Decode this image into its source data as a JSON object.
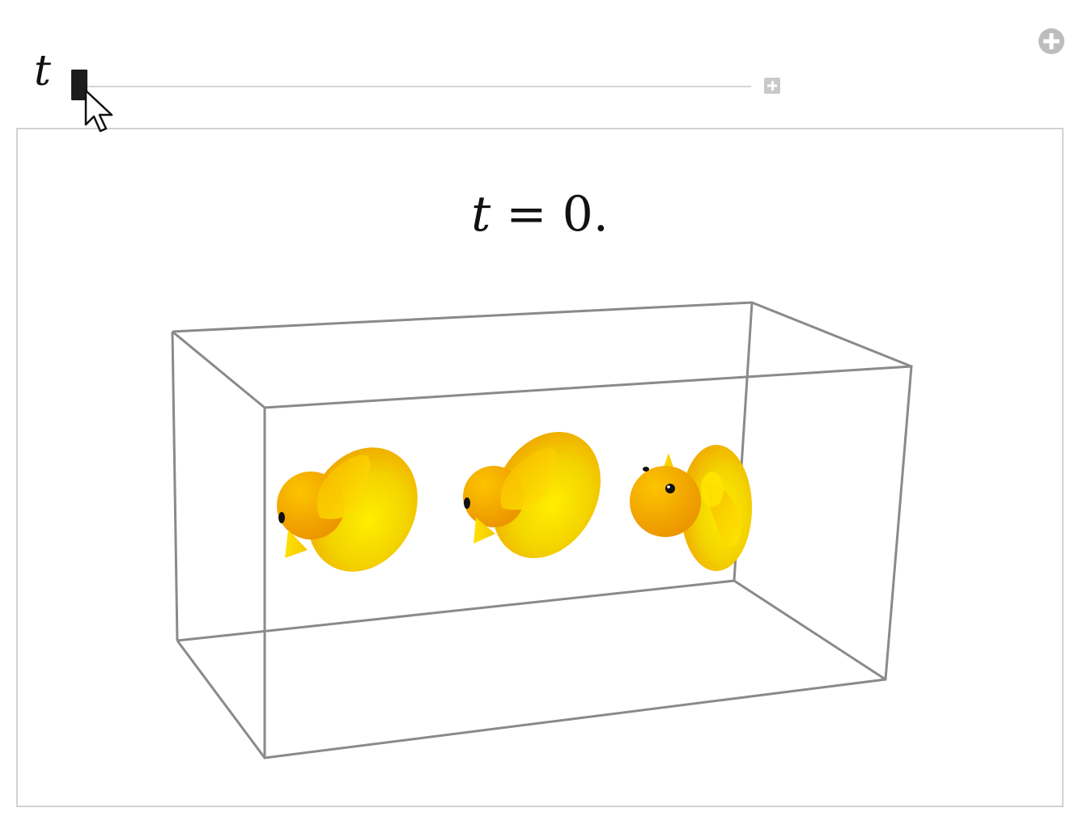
{
  "control": {
    "variable_label": "t",
    "value": 0,
    "expand_icon": "plus-square-icon"
  },
  "global_icon": "plus-circle-icon",
  "pointer_icon": "mouse-pointer-icon",
  "plot": {
    "title_var": "t",
    "title_rest": " = 0.",
    "object_icon": "rubber-duck",
    "box_color": "#8a8a8a",
    "duck_colors": [
      "#ffe600",
      "#f7a800",
      "#111111"
    ]
  }
}
